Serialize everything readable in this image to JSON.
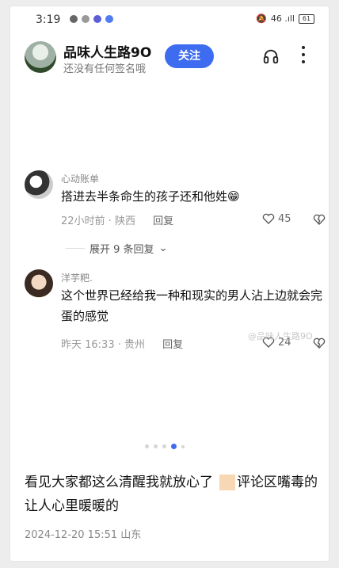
{
  "status_bar": {
    "time": "3:19",
    "right_text": "46 .ıll",
    "battery": "61"
  },
  "profile": {
    "name": "品味人生路9O",
    "signature": "还没有任何签名哦",
    "follow_label": "关注"
  },
  "comments": [
    {
      "username": "心动账单",
      "text": "搭进去半条命生的孩子还和他姓😁",
      "time_location": "22小时前 · 陕西",
      "reply_label": "回复",
      "likes": "45"
    },
    {
      "username": "洋芋粑.",
      "text": "这个世界已经给我一种和现实的男人沾上边就会完蛋的感觉",
      "time_location": "昨天 16:33 · 贵州",
      "reply_label": "回复",
      "likes": "24"
    }
  ],
  "expand_replies": "展开 9 条回复",
  "watermark": "@品味人生路9O",
  "pagination": {
    "total": 5,
    "active_index": 3
  },
  "post": {
    "text_part1": "看见大家都这么清醒我就放心了",
    "text_part2": "评论区嘴毒的让人心里暖暖的",
    "date_location": "2024-12-20 15:51  山东"
  },
  "colors": {
    "accent": "#3d6cf0",
    "highlight": "#f8d7b5"
  }
}
